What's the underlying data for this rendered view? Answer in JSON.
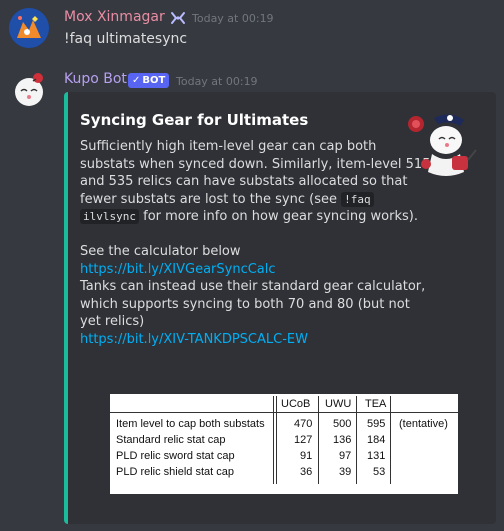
{
  "colors": {
    "background": "#36393f",
    "embed_background": "#2f3136",
    "embed_accent": "#1abc9c",
    "user1_name": "#e98da4",
    "user2_name": "#b7a0f0",
    "link": "#00aff4",
    "bot_badge": "#5865f2"
  },
  "messages": [
    {
      "username": "Mox Xinmagar",
      "timestamp": "Today at 00:19",
      "badge_icon": "owner-link-icon",
      "text": "!faq ultimatesync"
    },
    {
      "username": "Kupo Bot",
      "badge": "BOT",
      "timestamp": "Today at 00:19"
    }
  ],
  "embed": {
    "title": "Syncing Gear for Ultimates",
    "lines": [
      "Sufficiently high item-level gear can cap both",
      "substats when synced down. Similarly, item-level 515",
      "and 535 relics can have substats allocated so that",
      "fewer substats are lost to the sync (see"
    ],
    "code1": "!faq",
    "code2": "ilvlsync",
    "line5_rest": " for more info on how gear syncing works).",
    "see_calc": "See the calculator below",
    "link1": "https://bit.ly/XIVGearSyncCalc",
    "tank_lines": [
      "Tanks can instead use their standard gear calculator,",
      "which supports syncing to both 70 and 80 (but not",
      "yet relics)"
    ],
    "link2": "https://bit.ly/XIV-TANKDPSCALC-EW"
  },
  "table": {
    "headers": [
      "",
      "UCoB",
      "UWU",
      "TEA",
      ""
    ],
    "rows": [
      [
        "Item level to cap both substats",
        "470",
        "500",
        "595",
        "(tentative)"
      ],
      [
        "Standard relic stat cap",
        "127",
        "136",
        "184",
        ""
      ],
      [
        "PLD relic sword stat cap",
        "91",
        "97",
        "131",
        ""
      ],
      [
        "PLD relic shield stat cap",
        "36",
        "39",
        "53",
        ""
      ]
    ]
  }
}
